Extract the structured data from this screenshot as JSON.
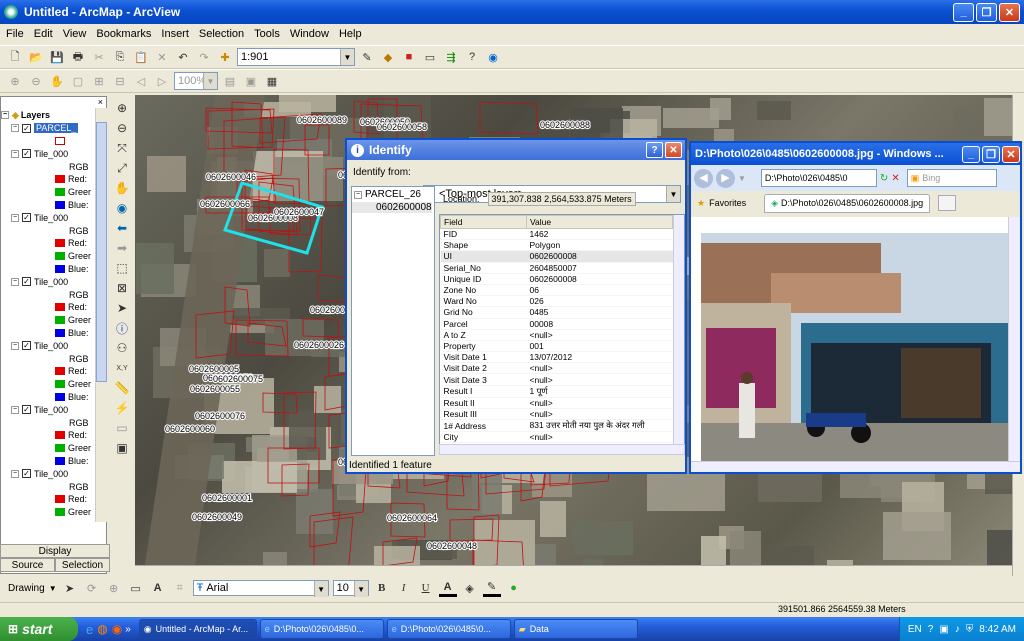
{
  "window": {
    "title": "Untitled - ArcMap - ArcView"
  },
  "menu": [
    "File",
    "Edit",
    "View",
    "Bookmarks",
    "Insert",
    "Selection",
    "Tools",
    "Window",
    "Help"
  ],
  "toolbar": {
    "scale": "1:901",
    "zoom": "100%"
  },
  "toc": {
    "root": "Layers",
    "rows": [
      {
        "kind": "layer",
        "label": "PARCEL_",
        "selected": true,
        "checked": true
      },
      {
        "kind": "symbol",
        "color": "#ffffff",
        "border": "#d00000",
        "label": ""
      },
      {
        "kind": "layer",
        "label": "Tile_000",
        "checked": true
      },
      {
        "kind": "sub",
        "label": "RGB"
      },
      {
        "kind": "band",
        "color": "#e00000",
        "label": "Red:"
      },
      {
        "kind": "band",
        "color": "#00b000",
        "label": "Greer"
      },
      {
        "kind": "band",
        "color": "#0000e0",
        "label": "Blue:"
      },
      {
        "kind": "layer",
        "label": "Tile_000",
        "checked": true
      },
      {
        "kind": "sub",
        "label": "RGB"
      },
      {
        "kind": "band",
        "color": "#e00000",
        "label": "Red:"
      },
      {
        "kind": "band",
        "color": "#00b000",
        "label": "Greer"
      },
      {
        "kind": "band",
        "color": "#0000e0",
        "label": "Blue:"
      },
      {
        "kind": "layer",
        "label": "Tile_000",
        "checked": true
      },
      {
        "kind": "sub",
        "label": "RGB"
      },
      {
        "kind": "band",
        "color": "#e00000",
        "label": "Red:"
      },
      {
        "kind": "band",
        "color": "#00b000",
        "label": "Greer"
      },
      {
        "kind": "band",
        "color": "#0000e0",
        "label": "Blue:"
      },
      {
        "kind": "layer",
        "label": "Tile_000",
        "checked": true
      },
      {
        "kind": "sub",
        "label": "RGB"
      },
      {
        "kind": "band",
        "color": "#e00000",
        "label": "Red:"
      },
      {
        "kind": "band",
        "color": "#00b000",
        "label": "Greer"
      },
      {
        "kind": "band",
        "color": "#0000e0",
        "label": "Blue:"
      },
      {
        "kind": "layer",
        "label": "Tile_000",
        "checked": true
      },
      {
        "kind": "sub",
        "label": "RGB"
      },
      {
        "kind": "band",
        "color": "#e00000",
        "label": "Red:"
      },
      {
        "kind": "band",
        "color": "#00b000",
        "label": "Greer"
      },
      {
        "kind": "band",
        "color": "#0000e0",
        "label": "Blue:"
      },
      {
        "kind": "layer",
        "label": "Tile_000",
        "checked": true
      },
      {
        "kind": "sub",
        "label": "RGB"
      },
      {
        "kind": "band",
        "color": "#e00000",
        "label": "Red:"
      },
      {
        "kind": "band",
        "color": "#00b000",
        "label": "Greer"
      }
    ],
    "tabs": {
      "display": "Display",
      "source": "Source",
      "selection": "Selection"
    }
  },
  "map_labels": [
    "0602600001",
    "0602600005",
    "0602600008",
    "0602600020",
    "0602600021",
    "0602600033",
    "0602600036",
    "0602600026",
    "0602600027",
    "0602600052",
    "0602600024",
    "0602600046",
    "0602600047",
    "0602600049",
    "0602600048",
    "0602600050",
    "0602600053",
    "0602600058",
    "0602600054A",
    "0602600060",
    "0602600055",
    "0602600064",
    "0602600075",
    "0602600074",
    "0602600076",
    "0602600094",
    "0602600073",
    "0602600090",
    "0602600089",
    "0602600088",
    "0602600067",
    "0602600066",
    "0602600065",
    "0602600097"
  ],
  "identify": {
    "title": "Identify",
    "from_label": "Identify from:",
    "from_value": "<Top-most layer>",
    "tree_layer": "PARCEL_26",
    "tree_feature": "0602600008",
    "location_label": "Location:",
    "location_value": "391,307.838  2,564,533.875 Meters",
    "col_field": "Field",
    "col_value": "Value",
    "rows": [
      [
        "FID",
        "1462"
      ],
      [
        "Shape",
        "Polygon"
      ],
      [
        "UI",
        "0602600008"
      ],
      [
        "Serial_No",
        "2604850007"
      ],
      [
        "Unique ID",
        "0602600008"
      ],
      [
        "Zone No",
        "06"
      ],
      [
        "Ward No",
        "026"
      ],
      [
        "Grid No",
        "0485"
      ],
      [
        "Parcel",
        "00008"
      ],
      [
        "A to Z",
        "<null>"
      ],
      [
        "Property",
        "001"
      ],
      [
        "Visit Date 1",
        "13/07/2012"
      ],
      [
        "Visit Date 2",
        "<null>"
      ],
      [
        "Visit Date 3",
        "<null>"
      ],
      [
        "Result I",
        "1 पूर्ण"
      ],
      [
        "Result  II",
        "<null>"
      ],
      [
        "Result III",
        "<null>"
      ],
      [
        "1# Address",
        "831 उत्तर मोती नया पुल के अंदर गली"
      ],
      [
        "City",
        "<null>"
      ]
    ],
    "status": "Identified 1 feature"
  },
  "photo": {
    "title": "D:\\Photo\\026\\0485\\0602600008.jpg - Windows ...",
    "address": "D:\\Photo\\026\\0485\\0",
    "search": "Bing",
    "favorites": "Favorites",
    "tab": "D:\\Photo\\026\\0485\\0602600008.jpg"
  },
  "draw": {
    "drawing": "Drawing",
    "font": "Arial",
    "size": "10",
    "bold": "B",
    "italic": "I",
    "underline": "U",
    "text_a": "A"
  },
  "status": {
    "coords": "391501.866  2564559.38 Meters"
  },
  "taskbar": {
    "start": "start",
    "tasks": [
      "Untitled - ArcMap - Ar...",
      "D:\\Photo\\026\\0485\\0...",
      "D:\\Photo\\026\\0485\\0...",
      "Data"
    ],
    "lang": "EN",
    "time": "8:42 AM"
  }
}
